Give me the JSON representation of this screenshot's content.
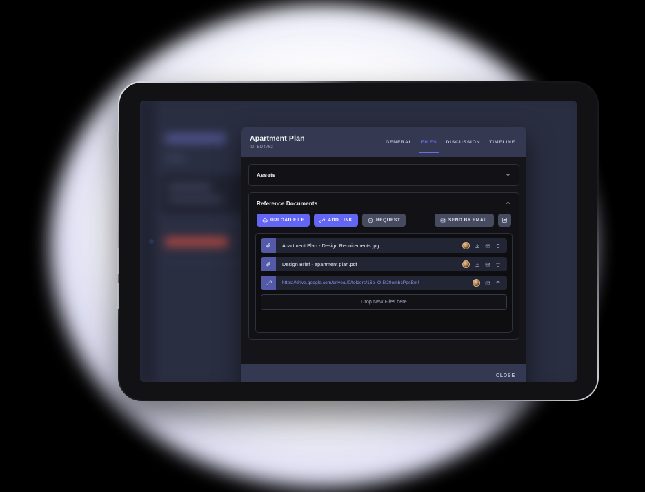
{
  "modal": {
    "title": "Apartment Plan",
    "id_label": "ID: ED4762",
    "tabs": [
      {
        "label": "GENERAL",
        "active": false
      },
      {
        "label": "FILES",
        "active": true
      },
      {
        "label": "DISCUSSION",
        "active": false
      },
      {
        "label": "TIMELINE",
        "active": false
      }
    ],
    "sections": {
      "assets": {
        "title": "Assets",
        "chevron": "chevron-down"
      },
      "reference_documents": {
        "title": "Reference Documents",
        "chevron": "chevron-up",
        "toolbar": {
          "upload_file": "UPLOAD FILE",
          "add_link": "ADD LINK",
          "request": "REQUEST",
          "send_by_email": "SEND BY EMAIL",
          "save_icon_name": "archive-box-icon"
        },
        "files": [
          {
            "name": "Apartment Plan - Design Requirements.jpg",
            "type": "file",
            "tag_icon": "paperclip-icon",
            "actions": [
              "avatar",
              "download-icon",
              "envelope-icon",
              "trash-icon"
            ]
          },
          {
            "name": "Design Brief - apartment plan.pdf",
            "type": "file",
            "tag_icon": "paperclip-icon",
            "actions": [
              "avatar",
              "download-icon",
              "envelope-icon",
              "trash-icon"
            ]
          },
          {
            "name": "https://drive.google.com/drive/u/0/folders/16o_O-5t20ombcPpeBm!",
            "type": "link",
            "tag_icon": "link-icon",
            "actions": [
              "avatar",
              "envelope-icon",
              "trash-icon"
            ]
          }
        ],
        "dropzone_label": "Drop New Files here"
      }
    },
    "footer": {
      "close_label": "CLOSE"
    }
  },
  "colors": {
    "accent": "#6365f3",
    "header_bg": "#343850",
    "modal_bg": "#151519",
    "tag_bg": "#555aa8",
    "link_text": "#8f93e2"
  }
}
